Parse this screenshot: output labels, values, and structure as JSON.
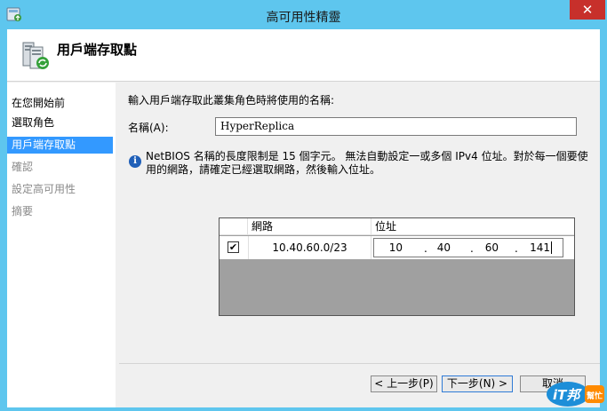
{
  "window": {
    "title": "高可用性精靈",
    "close_glyph": "✕"
  },
  "header": {
    "title": "用戶端存取點"
  },
  "sidebar": {
    "items": [
      {
        "label": "在您開始前",
        "state": "done"
      },
      {
        "label": "選取角色",
        "state": "done"
      },
      {
        "label": "用戶端存取點",
        "state": "active"
      },
      {
        "label": "確認",
        "state": "disabled"
      },
      {
        "label": "設定高可用性",
        "state": "disabled"
      },
      {
        "label": "摘要",
        "state": "disabled"
      }
    ]
  },
  "content": {
    "instruction": "輸入用戶端存取此叢集角色時將使用的名稱:",
    "name_label": "名稱(A):",
    "name_value": "HyperReplica",
    "info_icon": "i",
    "info_text": "NetBIOS 名稱的長度限制是 15 個字元。 無法自動設定一或多個 IPv4 位址。對於每一個要使用的網路，請確定已經選取網路，然後輸入位址。",
    "grid": {
      "headers": {
        "network": "網路",
        "address": "位址"
      },
      "rows": [
        {
          "checked": true,
          "check_glyph": "✔",
          "network": "10.40.60.0/23",
          "octets": [
            "10",
            "40",
            "60",
            "141"
          ],
          "separator": "."
        }
      ]
    }
  },
  "buttons": {
    "back": "< 上一步(P)",
    "next": "下一步(N) >",
    "cancel": "取消"
  },
  "logo": {
    "text": "iT邦幫忙",
    "colors": {
      "primary": "#1d8ed8",
      "accent": "#ff8a00"
    }
  },
  "colors": {
    "titlebar": "#5ec6ee",
    "close": "#c7302b",
    "selection": "#3399ff"
  }
}
